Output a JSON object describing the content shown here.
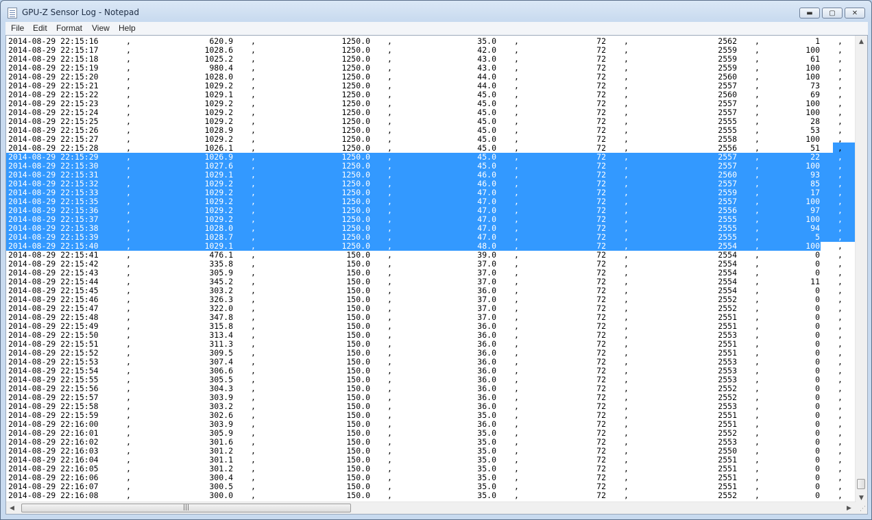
{
  "window": {
    "title": "GPU-Z Sensor Log - Notepad"
  },
  "menu": {
    "file": "File",
    "edit": "Edit",
    "format": "Format",
    "view": "View",
    "help": "Help"
  },
  "icons": {
    "app": "notepad-icon",
    "min": "minimize-icon",
    "max": "maximize-icon",
    "close": "close-icon"
  },
  "colors": {
    "selection": "#3399ff"
  },
  "selection": {
    "first_row_index": 13,
    "last_row_index": 24
  },
  "rows": [
    [
      "2014-08-29 22:15:16",
      "620.9",
      "1250.0",
      "35.0",
      "72",
      "2562",
      "1"
    ],
    [
      "2014-08-29 22:15:17",
      "1028.6",
      "1250.0",
      "42.0",
      "72",
      "2559",
      "100"
    ],
    [
      "2014-08-29 22:15:18",
      "1025.2",
      "1250.0",
      "43.0",
      "72",
      "2559",
      "61"
    ],
    [
      "2014-08-29 22:15:19",
      "980.4",
      "1250.0",
      "43.0",
      "72",
      "2559",
      "100"
    ],
    [
      "2014-08-29 22:15:20",
      "1028.0",
      "1250.0",
      "44.0",
      "72",
      "2560",
      "100"
    ],
    [
      "2014-08-29 22:15:21",
      "1029.2",
      "1250.0",
      "44.0",
      "72",
      "2557",
      "73"
    ],
    [
      "2014-08-29 22:15:22",
      "1029.1",
      "1250.0",
      "45.0",
      "72",
      "2560",
      "69"
    ],
    [
      "2014-08-29 22:15:23",
      "1029.2",
      "1250.0",
      "45.0",
      "72",
      "2557",
      "100"
    ],
    [
      "2014-08-29 22:15:24",
      "1029.2",
      "1250.0",
      "45.0",
      "72",
      "2557",
      "100"
    ],
    [
      "2014-08-29 22:15:25",
      "1029.2",
      "1250.0",
      "45.0",
      "72",
      "2555",
      "28"
    ],
    [
      "2014-08-29 22:15:26",
      "1028.9",
      "1250.0",
      "45.0",
      "72",
      "2555",
      "53"
    ],
    [
      "2014-08-29 22:15:27",
      "1029.2",
      "1250.0",
      "45.0",
      "72",
      "2558",
      "100"
    ],
    [
      "2014-08-29 22:15:28",
      "1026.1",
      "1250.0",
      "45.0",
      "72",
      "2556",
      "51"
    ],
    [
      "2014-08-29 22:15:29",
      "1026.9",
      "1250.0",
      "45.0",
      "72",
      "2557",
      "22"
    ],
    [
      "2014-08-29 22:15:30",
      "1027.6",
      "1250.0",
      "45.0",
      "72",
      "2557",
      "100"
    ],
    [
      "2014-08-29 22:15:31",
      "1029.1",
      "1250.0",
      "46.0",
      "72",
      "2560",
      "93"
    ],
    [
      "2014-08-29 22:15:32",
      "1029.2",
      "1250.0",
      "46.0",
      "72",
      "2557",
      "85"
    ],
    [
      "2014-08-29 22:15:33",
      "1029.2",
      "1250.0",
      "47.0",
      "72",
      "2559",
      "17"
    ],
    [
      "2014-08-29 22:15:35",
      "1029.2",
      "1250.0",
      "47.0",
      "72",
      "2557",
      "100"
    ],
    [
      "2014-08-29 22:15:36",
      "1029.2",
      "1250.0",
      "47.0",
      "72",
      "2556",
      "97"
    ],
    [
      "2014-08-29 22:15:37",
      "1029.2",
      "1250.0",
      "47.0",
      "72",
      "2555",
      "100"
    ],
    [
      "2014-08-29 22:15:38",
      "1028.0",
      "1250.0",
      "47.0",
      "72",
      "2555",
      "94"
    ],
    [
      "2014-08-29 22:15:39",
      "1028.7",
      "1250.0",
      "47.0",
      "72",
      "2555",
      "5"
    ],
    [
      "2014-08-29 22:15:40",
      "1029.1",
      "1250.0",
      "48.0",
      "72",
      "2554",
      "100"
    ],
    [
      "2014-08-29 22:15:41",
      "476.1",
      "150.0",
      "39.0",
      "72",
      "2554",
      "0"
    ],
    [
      "2014-08-29 22:15:42",
      "335.8",
      "150.0",
      "37.0",
      "72",
      "2554",
      "0"
    ],
    [
      "2014-08-29 22:15:43",
      "305.9",
      "150.0",
      "37.0",
      "72",
      "2554",
      "0"
    ],
    [
      "2014-08-29 22:15:44",
      "345.2",
      "150.0",
      "37.0",
      "72",
      "2554",
      "11"
    ],
    [
      "2014-08-29 22:15:45",
      "303.2",
      "150.0",
      "36.0",
      "72",
      "2554",
      "0"
    ],
    [
      "2014-08-29 22:15:46",
      "326.3",
      "150.0",
      "37.0",
      "72",
      "2552",
      "0"
    ],
    [
      "2014-08-29 22:15:47",
      "322.0",
      "150.0",
      "37.0",
      "72",
      "2552",
      "0"
    ],
    [
      "2014-08-29 22:15:48",
      "347.8",
      "150.0",
      "37.0",
      "72",
      "2551",
      "0"
    ],
    [
      "2014-08-29 22:15:49",
      "315.8",
      "150.0",
      "36.0",
      "72",
      "2551",
      "0"
    ],
    [
      "2014-08-29 22:15:50",
      "313.4",
      "150.0",
      "36.0",
      "72",
      "2553",
      "0"
    ],
    [
      "2014-08-29 22:15:51",
      "311.3",
      "150.0",
      "36.0",
      "72",
      "2551",
      "0"
    ],
    [
      "2014-08-29 22:15:52",
      "309.5",
      "150.0",
      "36.0",
      "72",
      "2551",
      "0"
    ],
    [
      "2014-08-29 22:15:53",
      "307.4",
      "150.0",
      "36.0",
      "72",
      "2553",
      "0"
    ],
    [
      "2014-08-29 22:15:54",
      "306.6",
      "150.0",
      "36.0",
      "72",
      "2553",
      "0"
    ],
    [
      "2014-08-29 22:15:55",
      "305.5",
      "150.0",
      "36.0",
      "72",
      "2553",
      "0"
    ],
    [
      "2014-08-29 22:15:56",
      "304.3",
      "150.0",
      "36.0",
      "72",
      "2552",
      "0"
    ],
    [
      "2014-08-29 22:15:57",
      "303.9",
      "150.0",
      "36.0",
      "72",
      "2552",
      "0"
    ],
    [
      "2014-08-29 22:15:58",
      "303.2",
      "150.0",
      "36.0",
      "72",
      "2553",
      "0"
    ],
    [
      "2014-08-29 22:15:59",
      "302.6",
      "150.0",
      "35.0",
      "72",
      "2551",
      "0"
    ],
    [
      "2014-08-29 22:16:00",
      "303.9",
      "150.0",
      "36.0",
      "72",
      "2551",
      "0"
    ],
    [
      "2014-08-29 22:16:01",
      "305.9",
      "150.0",
      "35.0",
      "72",
      "2552",
      "0"
    ],
    [
      "2014-08-29 22:16:02",
      "301.6",
      "150.0",
      "35.0",
      "72",
      "2553",
      "0"
    ],
    [
      "2014-08-29 22:16:03",
      "301.2",
      "150.0",
      "35.0",
      "72",
      "2550",
      "0"
    ],
    [
      "2014-08-29 22:16:04",
      "301.1",
      "150.0",
      "35.0",
      "72",
      "2551",
      "0"
    ],
    [
      "2014-08-29 22:16:05",
      "301.2",
      "150.0",
      "35.0",
      "72",
      "2551",
      "0"
    ],
    [
      "2014-08-29 22:16:06",
      "300.4",
      "150.0",
      "35.0",
      "72",
      "2551",
      "0"
    ],
    [
      "2014-08-29 22:16:07",
      "300.5",
      "150.0",
      "35.0",
      "72",
      "2551",
      "0"
    ],
    [
      "2014-08-29 22:16:08",
      "300.0",
      "150.0",
      "35.0",
      "72",
      "2552",
      "0"
    ]
  ],
  "separator": ","
}
